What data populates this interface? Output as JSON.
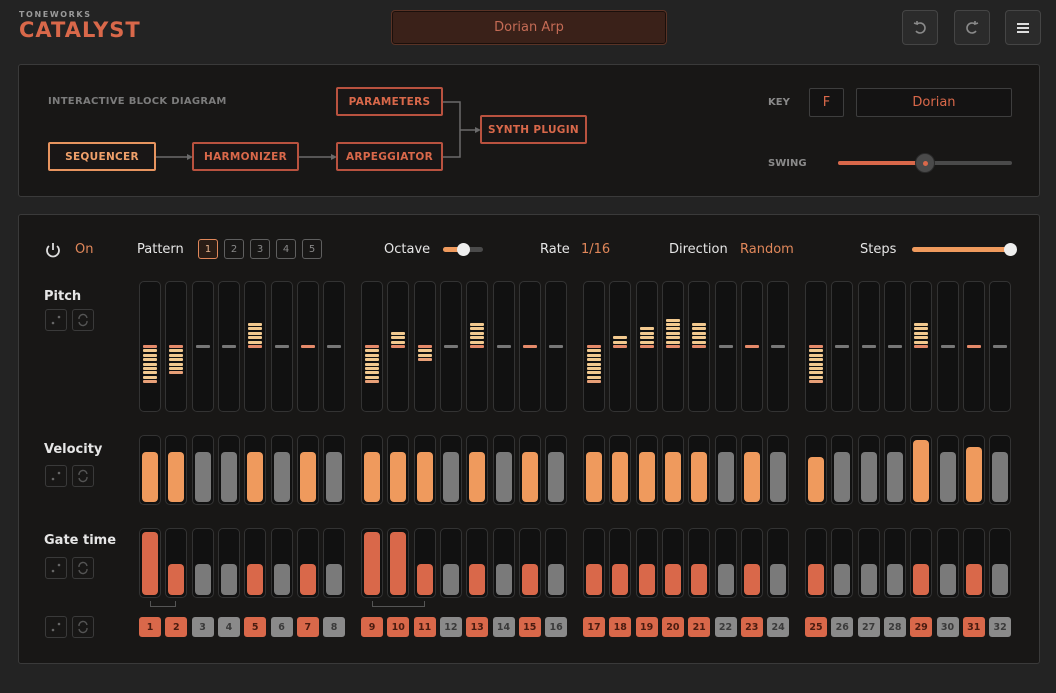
{
  "header": {
    "brand_sub": "TONEWORKS",
    "brand_main": "CATALYST",
    "preset_name": "Dorian Arp",
    "undo_icon": "undo-icon",
    "redo_icon": "redo-icon",
    "menu_icon": "hamburger-menu-icon"
  },
  "diagram": {
    "title": "INTERACTIVE BLOCK DIAGRAM",
    "blocks": {
      "sequencer": "SEQUENCER",
      "harmonizer": "HARMONIZER",
      "parameters": "PARAMETERS",
      "arpeggiator": "ARPEGGIATOR",
      "synth": "SYNTH PLUGIN"
    },
    "key_label": "KEY",
    "key_value": "F",
    "scale_value": "Dorian",
    "swing_label": "SWING",
    "swing_value": 0.5
  },
  "controls": {
    "power_label": "On",
    "pattern_label": "Pattern",
    "patterns": [
      "1",
      "2",
      "3",
      "4",
      "5"
    ],
    "active_pattern": 0,
    "octave_label": "Octave",
    "octave_value": 0.5,
    "rate_label": "Rate",
    "rate_value": "1/16",
    "direction_label": "Direction",
    "direction_value": "Random",
    "steps_label": "Steps",
    "steps_value": 1.0
  },
  "rows": {
    "pitch_label": "Pitch",
    "velocity_label": "Velocity",
    "gate_label": "Gate time"
  },
  "colors": {
    "accent": "#d9684a",
    "orange": "#ef9a5d",
    "pitch_seg": "#f2c98f",
    "inactive": "#7a7a7a"
  },
  "steps": {
    "active": [
      1,
      1,
      0,
      0,
      1,
      0,
      1,
      0,
      1,
      1,
      1,
      0,
      1,
      0,
      1,
      0,
      1,
      1,
      1,
      1,
      1,
      0,
      1,
      0,
      1,
      0,
      0,
      0,
      1,
      0,
      1,
      0
    ],
    "pitch": [
      -8,
      -6,
      0,
      0,
      5,
      0,
      0,
      0,
      -8,
      3,
      -3,
      0,
      5,
      0,
      0,
      0,
      -8,
      2,
      4,
      6,
      5,
      0,
      0,
      0,
      -8,
      0,
      0,
      0,
      5,
      0,
      0,
      0
    ],
    "velocity": [
      0.8,
      0.8,
      0.8,
      0.8,
      0.8,
      0.8,
      0.8,
      0.8,
      0.8,
      0.8,
      0.8,
      0.8,
      0.8,
      0.8,
      0.8,
      0.8,
      0.8,
      0.8,
      0.8,
      0.8,
      0.8,
      0.8,
      0.8,
      0.8,
      0.72,
      0.8,
      0.8,
      0.8,
      0.98,
      0.8,
      0.88,
      0.8
    ],
    "gate": [
      1.0,
      0.5,
      0.5,
      0.5,
      0.5,
      0.5,
      0.5,
      0.5,
      1.0,
      1.0,
      0.5,
      0.5,
      0.5,
      0.5,
      0.5,
      0.5,
      0.5,
      0.5,
      0.5,
      0.5,
      0.5,
      0.5,
      0.5,
      0.5,
      0.5,
      0.5,
      0.5,
      0.5,
      0.5,
      0.5,
      0.5,
      0.5
    ],
    "ties": [
      [
        1,
        2
      ],
      [
        9,
        11
      ]
    ],
    "numbers": [
      "1",
      "2",
      "3",
      "4",
      "5",
      "6",
      "7",
      "8",
      "9",
      "10",
      "11",
      "12",
      "13",
      "14",
      "15",
      "16",
      "17",
      "18",
      "19",
      "20",
      "21",
      "22",
      "23",
      "24",
      "25",
      "26",
      "27",
      "28",
      "29",
      "30",
      "31",
      "32"
    ]
  }
}
